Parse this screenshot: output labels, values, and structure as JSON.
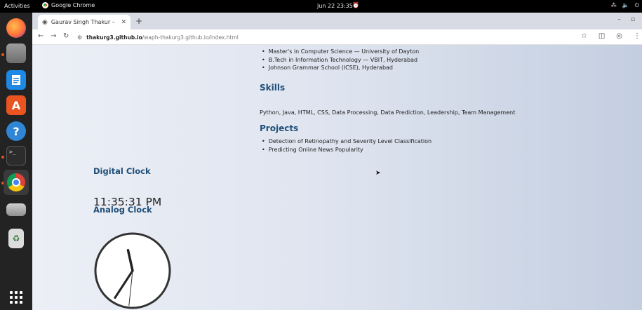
{
  "topbar": {
    "activities": "Activities",
    "app_name": "Google Chrome",
    "datetime": "Jun 22  23:35"
  },
  "dock": {
    "items": [
      "firefox-icon",
      "files-icon",
      "writer-icon",
      "app-store-icon",
      "help-icon",
      "terminal-icon",
      "chrome-icon",
      "drive-icon",
      "trash-icon",
      "show-apps-icon"
    ]
  },
  "browser": {
    "tab_title": "Gaurav Singh Thakur – P",
    "url_host": "thakurg3.github.io",
    "url_path": "/waph-thakurg3.github.io/index.html"
  },
  "page": {
    "education": [
      "Master's in Computer Science — University of Dayton",
      "B.Tech in Information Technology — VBIT, Hyderabad",
      "Johnson Grammar School (ICSE), Hyderabad"
    ],
    "skills_heading": "Skills",
    "skills_text": "Python, Java, HTML, CSS, Data Processing, Data Prediction, Leadership, Team Management",
    "projects_heading": "Projects",
    "projects": [
      "Detection of Retinopathy and Severity Level Classification",
      "Predicting Online News Popularity"
    ],
    "digital_clock_heading": "Digital Clock",
    "digital_time": "11:35:31 PM",
    "analog_clock_heading": "Analog Clock",
    "analog_time": {
      "hour": 23,
      "minute": 35,
      "second": 31
    }
  },
  "colors": {
    "heading": "#1f4e79",
    "ubuntu_accent": "#e95420"
  }
}
